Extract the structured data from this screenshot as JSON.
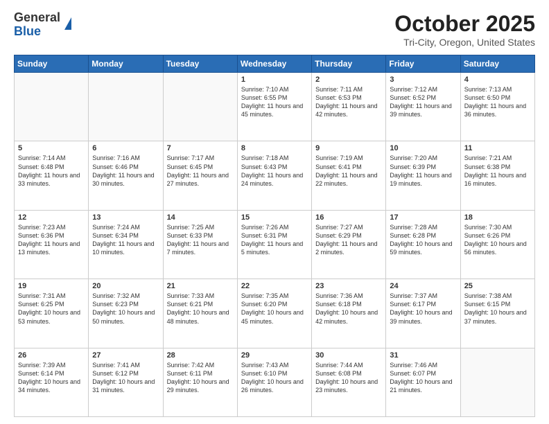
{
  "header": {
    "logo_general": "General",
    "logo_blue": "Blue",
    "month_title": "October 2025",
    "subtitle": "Tri-City, Oregon, United States"
  },
  "weekdays": [
    "Sunday",
    "Monday",
    "Tuesday",
    "Wednesday",
    "Thursday",
    "Friday",
    "Saturday"
  ],
  "weeks": [
    [
      {
        "day": "",
        "info": ""
      },
      {
        "day": "",
        "info": ""
      },
      {
        "day": "",
        "info": ""
      },
      {
        "day": "1",
        "info": "Sunrise: 7:10 AM\nSunset: 6:55 PM\nDaylight: 11 hours and 45 minutes."
      },
      {
        "day": "2",
        "info": "Sunrise: 7:11 AM\nSunset: 6:53 PM\nDaylight: 11 hours and 42 minutes."
      },
      {
        "day": "3",
        "info": "Sunrise: 7:12 AM\nSunset: 6:52 PM\nDaylight: 11 hours and 39 minutes."
      },
      {
        "day": "4",
        "info": "Sunrise: 7:13 AM\nSunset: 6:50 PM\nDaylight: 11 hours and 36 minutes."
      }
    ],
    [
      {
        "day": "5",
        "info": "Sunrise: 7:14 AM\nSunset: 6:48 PM\nDaylight: 11 hours and 33 minutes."
      },
      {
        "day": "6",
        "info": "Sunrise: 7:16 AM\nSunset: 6:46 PM\nDaylight: 11 hours and 30 minutes."
      },
      {
        "day": "7",
        "info": "Sunrise: 7:17 AM\nSunset: 6:45 PM\nDaylight: 11 hours and 27 minutes."
      },
      {
        "day": "8",
        "info": "Sunrise: 7:18 AM\nSunset: 6:43 PM\nDaylight: 11 hours and 24 minutes."
      },
      {
        "day": "9",
        "info": "Sunrise: 7:19 AM\nSunset: 6:41 PM\nDaylight: 11 hours and 22 minutes."
      },
      {
        "day": "10",
        "info": "Sunrise: 7:20 AM\nSunset: 6:39 PM\nDaylight: 11 hours and 19 minutes."
      },
      {
        "day": "11",
        "info": "Sunrise: 7:21 AM\nSunset: 6:38 PM\nDaylight: 11 hours and 16 minutes."
      }
    ],
    [
      {
        "day": "12",
        "info": "Sunrise: 7:23 AM\nSunset: 6:36 PM\nDaylight: 11 hours and 13 minutes."
      },
      {
        "day": "13",
        "info": "Sunrise: 7:24 AM\nSunset: 6:34 PM\nDaylight: 11 hours and 10 minutes."
      },
      {
        "day": "14",
        "info": "Sunrise: 7:25 AM\nSunset: 6:33 PM\nDaylight: 11 hours and 7 minutes."
      },
      {
        "day": "15",
        "info": "Sunrise: 7:26 AM\nSunset: 6:31 PM\nDaylight: 11 hours and 5 minutes."
      },
      {
        "day": "16",
        "info": "Sunrise: 7:27 AM\nSunset: 6:29 PM\nDaylight: 11 hours and 2 minutes."
      },
      {
        "day": "17",
        "info": "Sunrise: 7:28 AM\nSunset: 6:28 PM\nDaylight: 10 hours and 59 minutes."
      },
      {
        "day": "18",
        "info": "Sunrise: 7:30 AM\nSunset: 6:26 PM\nDaylight: 10 hours and 56 minutes."
      }
    ],
    [
      {
        "day": "19",
        "info": "Sunrise: 7:31 AM\nSunset: 6:25 PM\nDaylight: 10 hours and 53 minutes."
      },
      {
        "day": "20",
        "info": "Sunrise: 7:32 AM\nSunset: 6:23 PM\nDaylight: 10 hours and 50 minutes."
      },
      {
        "day": "21",
        "info": "Sunrise: 7:33 AM\nSunset: 6:21 PM\nDaylight: 10 hours and 48 minutes."
      },
      {
        "day": "22",
        "info": "Sunrise: 7:35 AM\nSunset: 6:20 PM\nDaylight: 10 hours and 45 minutes."
      },
      {
        "day": "23",
        "info": "Sunrise: 7:36 AM\nSunset: 6:18 PM\nDaylight: 10 hours and 42 minutes."
      },
      {
        "day": "24",
        "info": "Sunrise: 7:37 AM\nSunset: 6:17 PM\nDaylight: 10 hours and 39 minutes."
      },
      {
        "day": "25",
        "info": "Sunrise: 7:38 AM\nSunset: 6:15 PM\nDaylight: 10 hours and 37 minutes."
      }
    ],
    [
      {
        "day": "26",
        "info": "Sunrise: 7:39 AM\nSunset: 6:14 PM\nDaylight: 10 hours and 34 minutes."
      },
      {
        "day": "27",
        "info": "Sunrise: 7:41 AM\nSunset: 6:12 PM\nDaylight: 10 hours and 31 minutes."
      },
      {
        "day": "28",
        "info": "Sunrise: 7:42 AM\nSunset: 6:11 PM\nDaylight: 10 hours and 29 minutes."
      },
      {
        "day": "29",
        "info": "Sunrise: 7:43 AM\nSunset: 6:10 PM\nDaylight: 10 hours and 26 minutes."
      },
      {
        "day": "30",
        "info": "Sunrise: 7:44 AM\nSunset: 6:08 PM\nDaylight: 10 hours and 23 minutes."
      },
      {
        "day": "31",
        "info": "Sunrise: 7:46 AM\nSunset: 6:07 PM\nDaylight: 10 hours and 21 minutes."
      },
      {
        "day": "",
        "info": ""
      }
    ]
  ]
}
